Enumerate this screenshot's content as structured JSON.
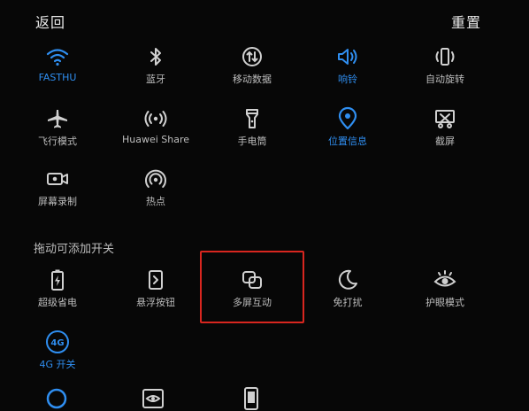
{
  "header": {
    "back_label": "返回",
    "reset_label": "重置"
  },
  "colors": {
    "background": "#070707",
    "accent": "#2f8ef0",
    "highlight": "#d8261f",
    "text": "#bdbdbd"
  },
  "active_tiles": [
    {
      "label": "FASTHU",
      "icon": "wifi-icon",
      "active": true
    },
    {
      "label": "蓝牙",
      "icon": "bluetooth-icon",
      "active": false
    },
    {
      "label": "移动数据",
      "icon": "mobile-data-icon",
      "active": false
    },
    {
      "label": "响铃",
      "icon": "ring-icon",
      "active": true
    },
    {
      "label": "自动旋转",
      "icon": "auto-rotate-icon",
      "active": false
    },
    {
      "label": "飞行模式",
      "icon": "airplane-icon",
      "active": false
    },
    {
      "label": "Huawei Share",
      "icon": "huawei-share-icon",
      "active": false
    },
    {
      "label": "手电筒",
      "icon": "flashlight-icon",
      "active": false
    },
    {
      "label": "位置信息",
      "icon": "location-icon",
      "active": true
    },
    {
      "label": "截屏",
      "icon": "screenshot-icon",
      "active": false
    },
    {
      "label": "屏幕录制",
      "icon": "screen-record-icon",
      "active": false
    },
    {
      "label": "热点",
      "icon": "hotspot-icon",
      "active": false
    }
  ],
  "available_section_label": "拖动可添加开关",
  "available_tiles": [
    {
      "label": "超级省电",
      "icon": "battery-saver-icon",
      "active": false
    },
    {
      "label": "悬浮按钮",
      "icon": "floating-button-icon",
      "active": false
    },
    {
      "label": "多屏互动",
      "icon": "multi-screen-icon",
      "active": false,
      "highlighted": true
    },
    {
      "label": "免打扰",
      "icon": "moon-icon",
      "active": false
    },
    {
      "label": "护眼模式",
      "icon": "eye-comfort-icon",
      "active": false
    },
    {
      "label": "4G 开关",
      "icon": "4g-icon",
      "active": true
    }
  ],
  "partial_row_icons": [
    "circle-icon",
    "eye-box-icon",
    "phone-icon"
  ]
}
